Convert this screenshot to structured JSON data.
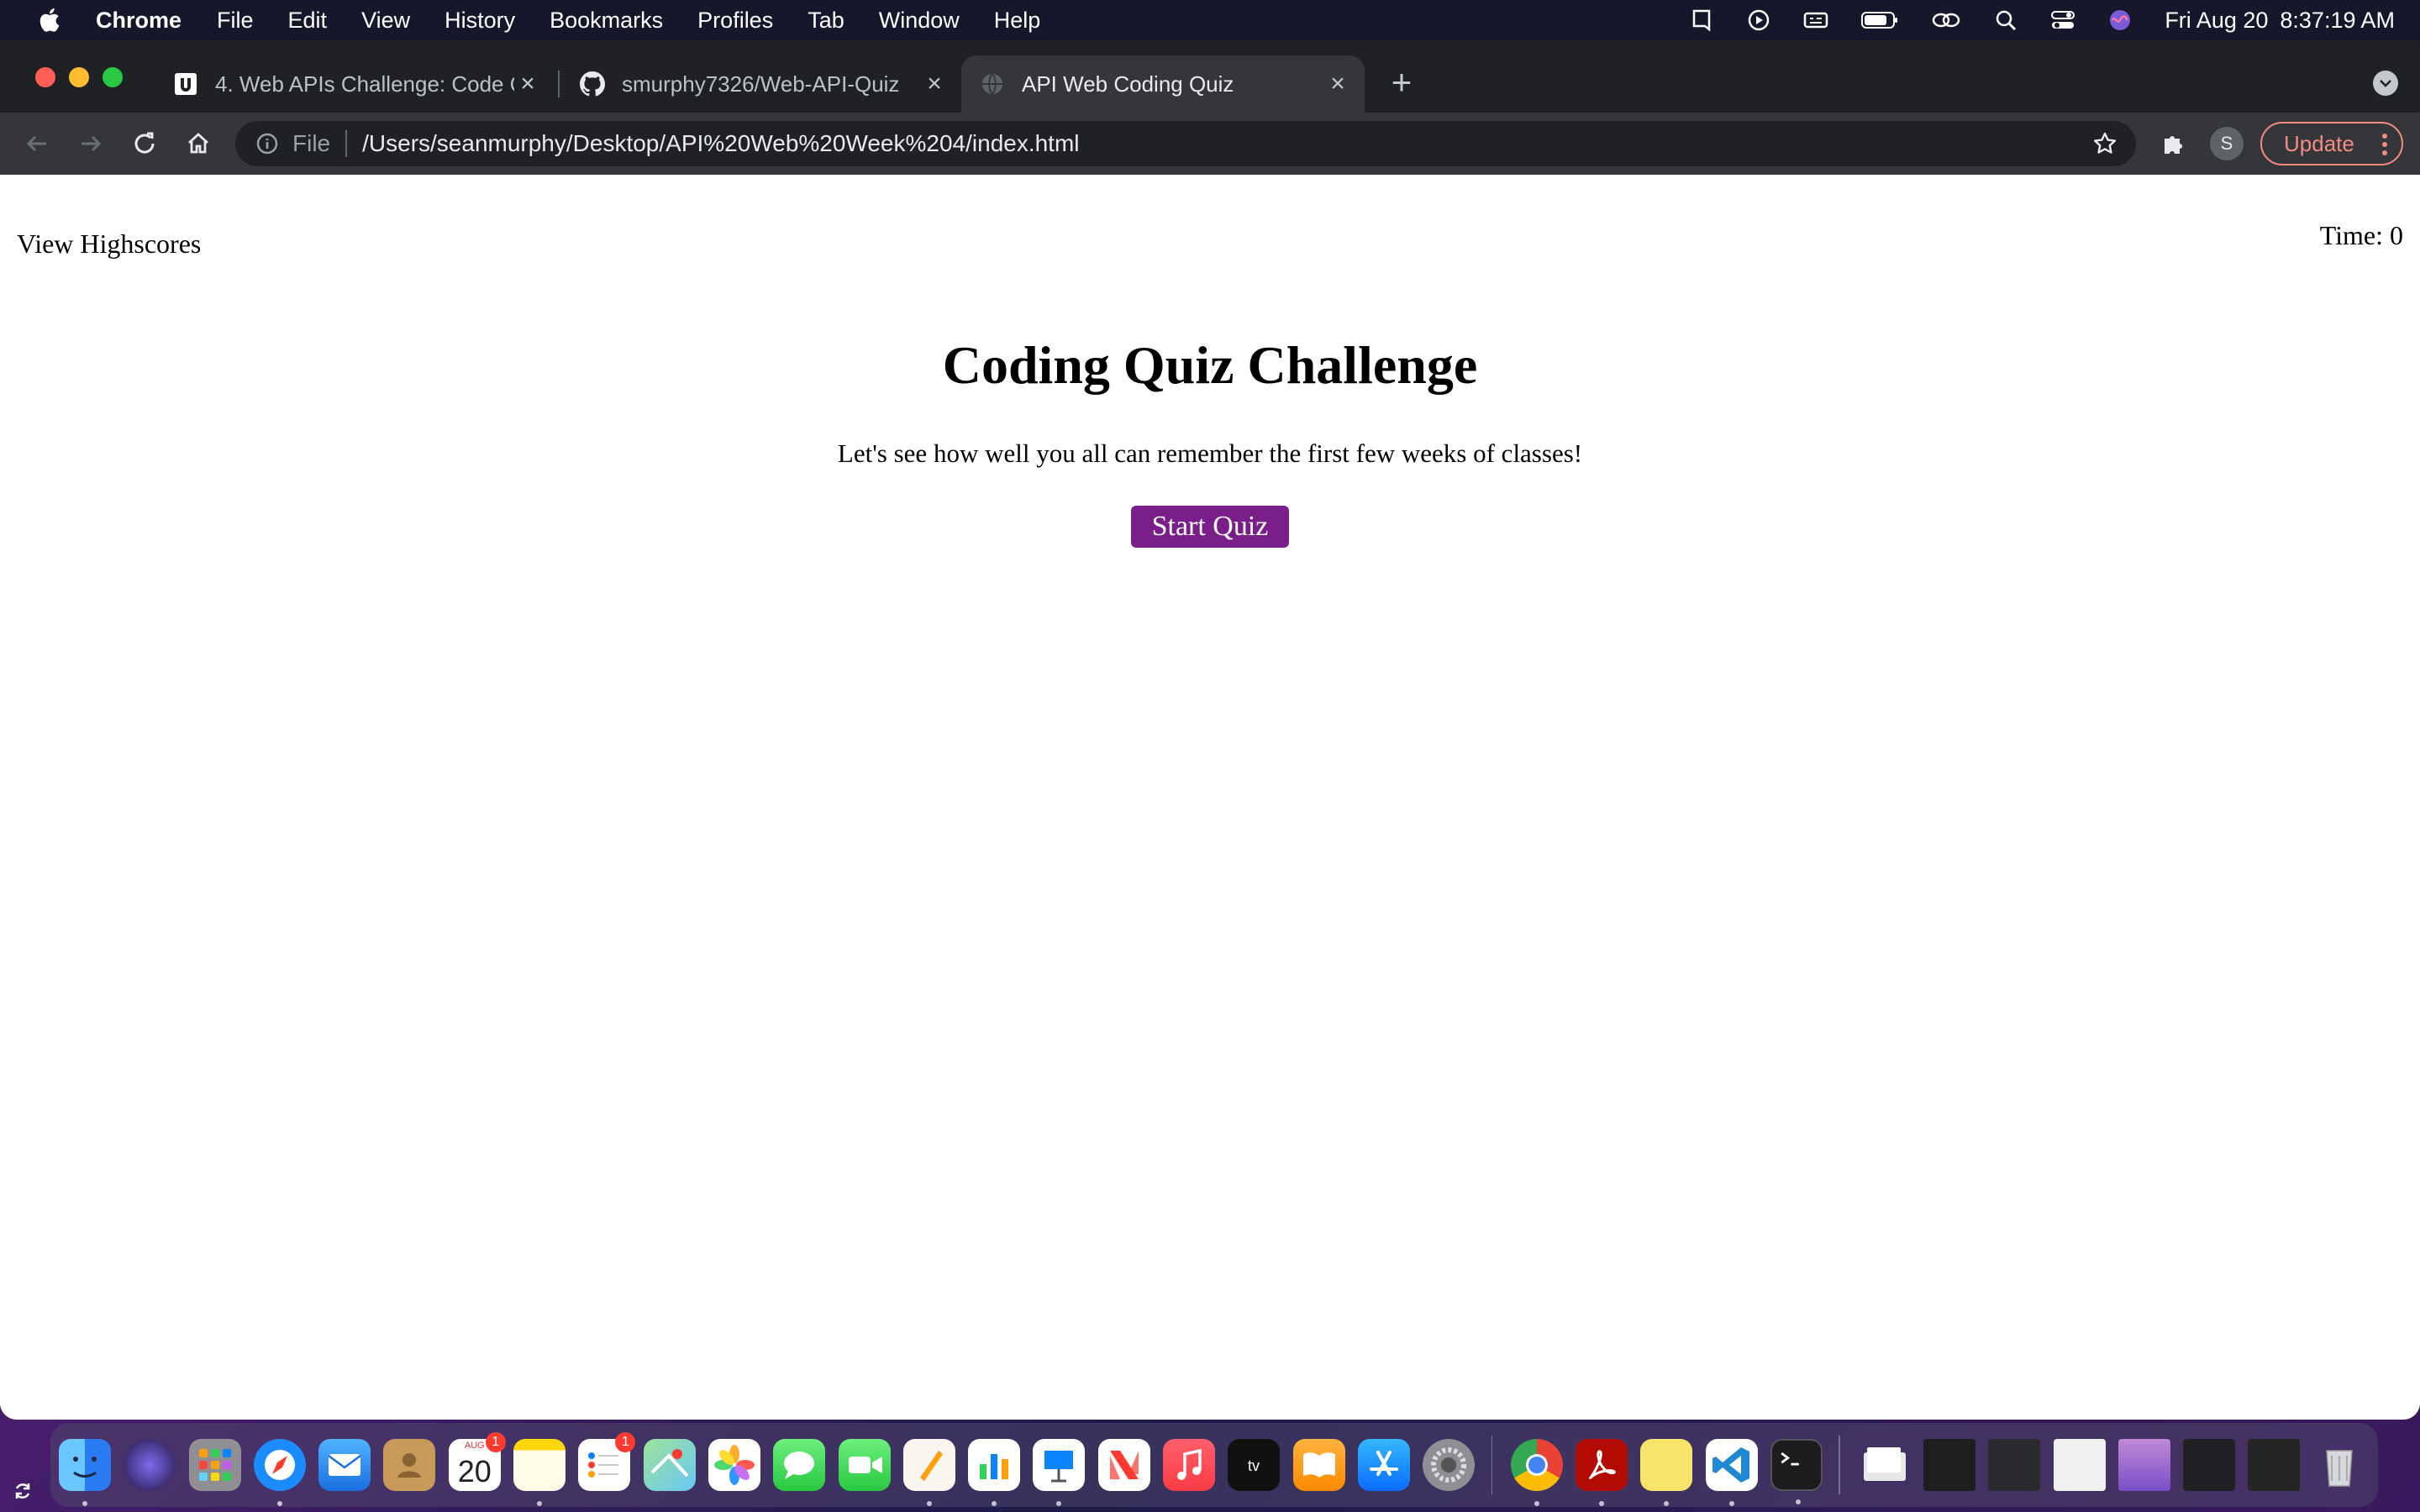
{
  "menubar": {
    "app_name": "Chrome",
    "menus": [
      "File",
      "Edit",
      "View",
      "History",
      "Bookmarks",
      "Profiles",
      "Tab",
      "Window",
      "Help"
    ],
    "clock_date": "Fri Aug 20",
    "clock_time": "8:37:19 AM"
  },
  "tabs": [
    {
      "title": "4. Web APIs Challenge: Code Q",
      "icon": "udemy-icon",
      "active": false
    },
    {
      "title": "smurphy7326/Web-API-Quiz",
      "icon": "github-icon",
      "active": false
    },
    {
      "title": "API Web Coding Quiz",
      "icon": "globe-icon",
      "active": true
    }
  ],
  "omnibox": {
    "scheme": "File",
    "url": "/Users/seanmurphy/Desktop/API%20Web%20Week%204/index.html"
  },
  "profile": {
    "initial": "S"
  },
  "update_label": "Update",
  "page": {
    "highscores_link": "View Highscores",
    "timer": "Time: 0",
    "title": "Coding Quiz Challenge",
    "description": "Let's see how well you all can remember the first few weeks of classes!",
    "start_button": "Start Quiz",
    "start_button_color": "#7a1e8a"
  },
  "dock": {
    "calendar_month": "AUG",
    "calendar_day": "20",
    "calendar_badge": "1",
    "reminders_badge": "1"
  }
}
